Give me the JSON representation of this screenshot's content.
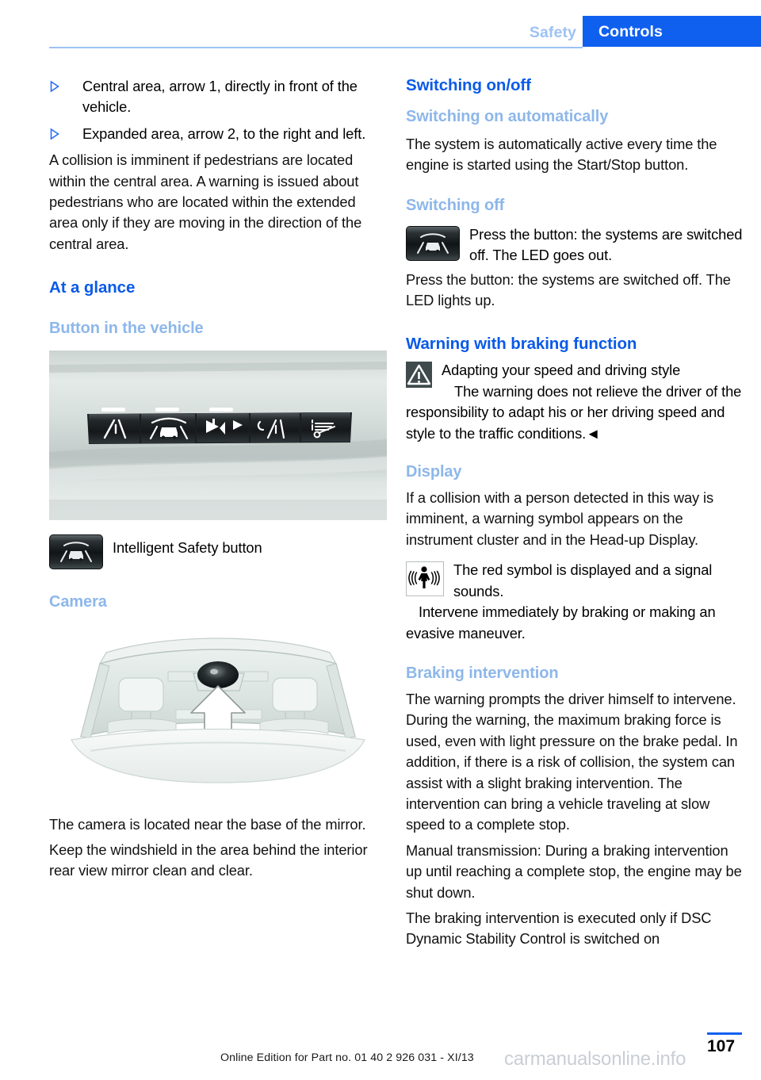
{
  "header": {
    "chapter": "Safety",
    "section": "Controls",
    "accent_blue": "#1060f0",
    "light_blue": "#9dc2f5"
  },
  "left_column": {
    "bullets": [
      "Central area, arrow 1, directly in front of the vehicle.",
      "Expanded area, arrow 2, to the right and left."
    ],
    "paragraph_collision": "A collision is imminent if pedestrians are located within the central area. A warning is issued about pedestrians who are located within the extended area only if they are moving in the direction of the central area.",
    "heading_at_a_glance": "At a glance",
    "heading_button_in_vehicle": "Button in the vehicle",
    "figure_buttons_caption": "",
    "intelligent_safety_label": "Intelligent Safety button",
    "heading_camera": "Camera",
    "paragraph_camera_location": "The camera is located near the base of the mirror.",
    "paragraph_windshield": "Keep the windshield in the area behind the interior rear view mirror clean and clear."
  },
  "right_column": {
    "heading_switching_onoff": "Switching on/off",
    "heading_switching_on_auto": "Switching on automatically",
    "paragraph_auto": "The system is automatically active every time the engine is started using the Start/Stop button.",
    "heading_switching_off": "Switching off",
    "icon_paragraph_off": "Press the button: the systems are switched off. The LED goes out.",
    "paragraph_off2": "Press the button: the systems are switched off. The LED lights up.",
    "heading_warning_braking": "Warning with braking function",
    "warning_title": "Adapting your speed and driving style",
    "warning_body": "The warning does not relieve the driver of the responsibility to adapt his or her driving speed and style to the traffic conditions.◄",
    "heading_display": "Display",
    "paragraph_display": "If a collision with a person detected in this way is imminent, a warning symbol appears on the instrument cluster and in the Head-up Display.",
    "icon_paragraph_red_symbol": "The red symbol is displayed and a signal sounds.",
    "paragraph_intervene": "Intervene immediately by braking or making an evasive maneuver.",
    "heading_braking_intervention": "Braking intervention",
    "paragraph_braking1": "The warning prompts the driver himself to intervene. During the warning, the maximum braking force is used, even with light pressure on the brake pedal. In addition, if there is a risk of collision, the system can assist with a slight braking intervention. The intervention can bring a vehicle traveling at slow speed to a complete stop.",
    "paragraph_braking2": "Manual transmission: During a braking intervention up until reaching a complete stop, the engine may be shut down.",
    "paragraph_braking3": "The braking intervention is executed only if DSC Dynamic Stability Control is switched on"
  },
  "footer": {
    "edition": "Online Edition for Part no. 01 40 2 926 031 - XI/13",
    "page_number": "107",
    "watermark": "carmanualsonline.info"
  },
  "icons": {
    "bullet": "triangle-right-outline-icon",
    "intelligent_safety": "intelligent-safety-button-icon",
    "warning": "warning-triangle-icon",
    "pedestrian": "pedestrian-warning-symbol-icon"
  }
}
